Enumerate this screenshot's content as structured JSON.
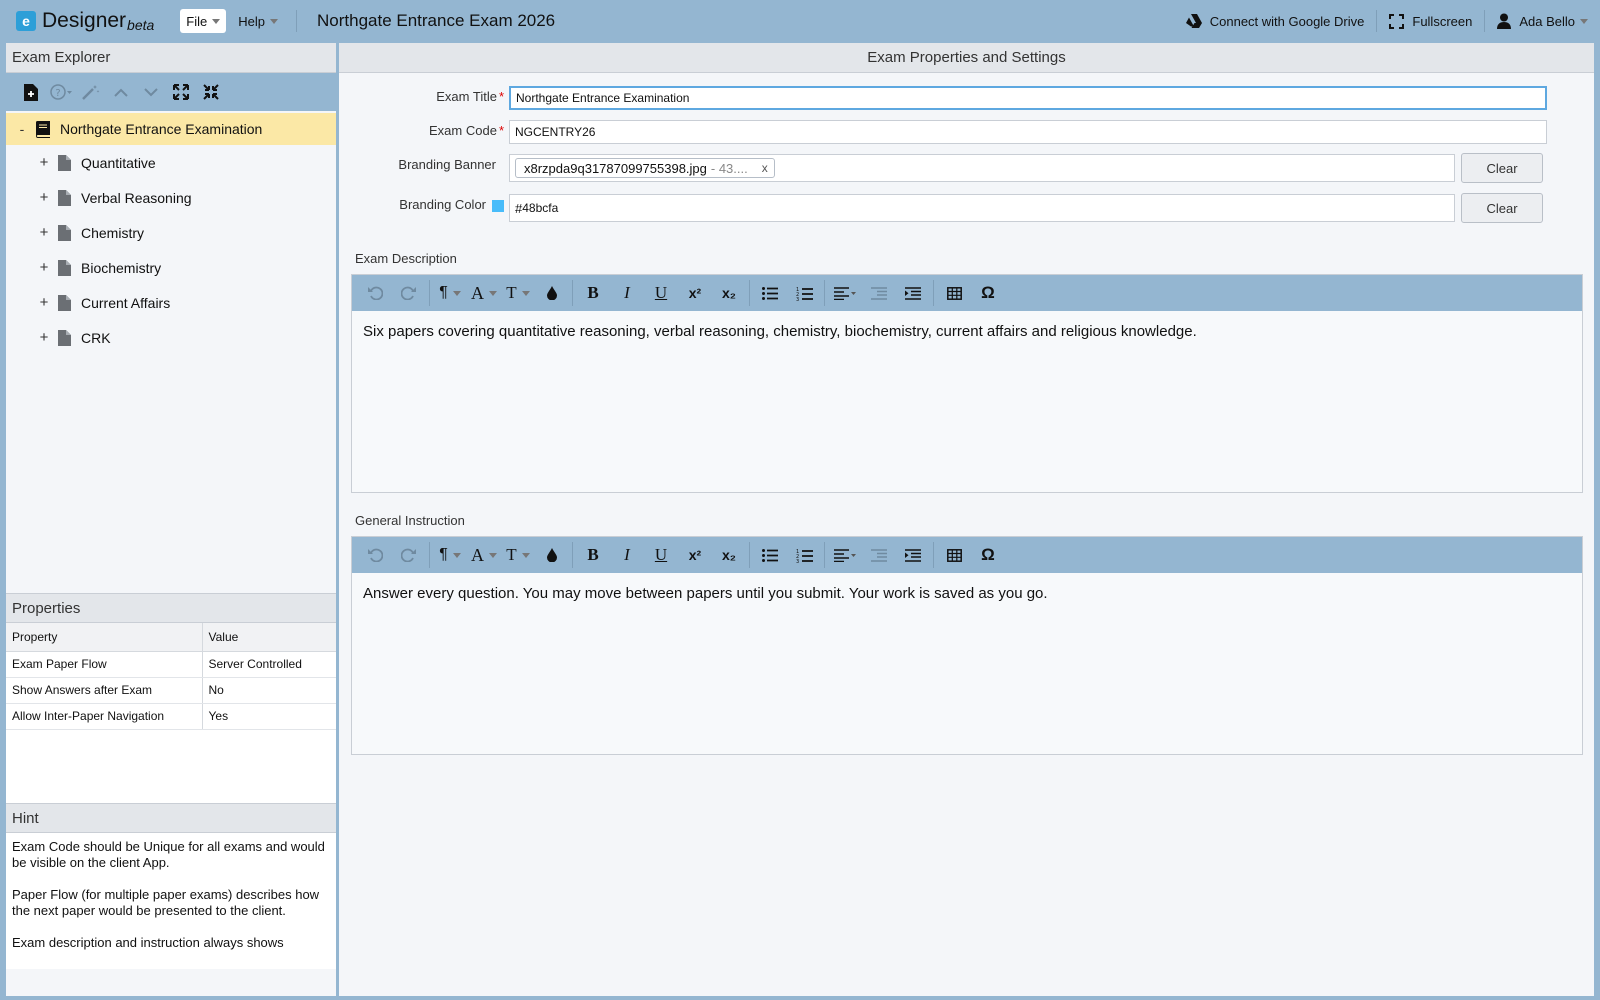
{
  "app": {
    "logo_letter": "e",
    "name": "Designer",
    "badge": "beta"
  },
  "menu": {
    "file": "File",
    "help": "Help"
  },
  "document_title": "Northgate Entrance Exam 2026",
  "topright": {
    "drive": "Connect with Google Drive",
    "fullscreen": "Fullscreen",
    "user": "Ada Bello"
  },
  "explorer": {
    "title": "Exam Explorer",
    "root": {
      "toggle": "-",
      "label": "Northgate Entrance Examination"
    },
    "items": [
      {
        "toggle": "+",
        "label": "Quantitative"
      },
      {
        "toggle": "+",
        "label": "Verbal Reasoning"
      },
      {
        "toggle": "+",
        "label": "Chemistry"
      },
      {
        "toggle": "+",
        "label": "Biochemistry"
      },
      {
        "toggle": "+",
        "label": "Current Affairs"
      },
      {
        "toggle": "+",
        "label": "CRK"
      }
    ]
  },
  "properties": {
    "title": "Properties",
    "col_property": "Property",
    "col_value": "Value",
    "rows": [
      {
        "property": "Exam Paper Flow",
        "value": "Server Controlled"
      },
      {
        "property": "Show Answers after Exam",
        "value": "No"
      },
      {
        "property": "Allow Inter-Paper Navigation",
        "value": "Yes"
      }
    ]
  },
  "hint": {
    "title": "Hint",
    "paragraphs": [
      "Exam Code should be Unique for all exams and would be visible on the client App.",
      "Paper Flow (for multiple paper exams) describes how the next paper would be presented to the client.",
      "Exam description and instruction always shows"
    ]
  },
  "settings": {
    "title": "Exam Properties and Settings",
    "required_mark": "*",
    "exam_title": {
      "label": "Exam Title",
      "value": "Northgate Entrance Examination"
    },
    "exam_code": {
      "label": "Exam Code",
      "value": "NGCENTRY26"
    },
    "branding_banner": {
      "label": "Branding Banner",
      "file": "x8rzpda9q31787099755398.jpg",
      "file_meta": "- 43....",
      "remove": "x",
      "clear": "Clear"
    },
    "branding_color": {
      "label": "Branding Color",
      "hash": "#",
      "value": "48bcfa",
      "swatch": "#48bcfa",
      "clear": "Clear"
    }
  },
  "description": {
    "label": "Exam Description",
    "text": "Six papers covering quantitative reasoning, verbal reasoning, chemistry, biochemistry, current affairs and religious knowledge."
  },
  "instruction": {
    "label": "General Instruction",
    "text": "Answer every question. You may move between papers until you submit. Your work is saved as you go."
  },
  "editor_glyphs": {
    "paragraph": "¶",
    "font": "A",
    "size": "T",
    "bold": "B",
    "italic": "I",
    "underline": "U",
    "sup": "x²",
    "sub": "x₂",
    "omega": "Ω"
  }
}
